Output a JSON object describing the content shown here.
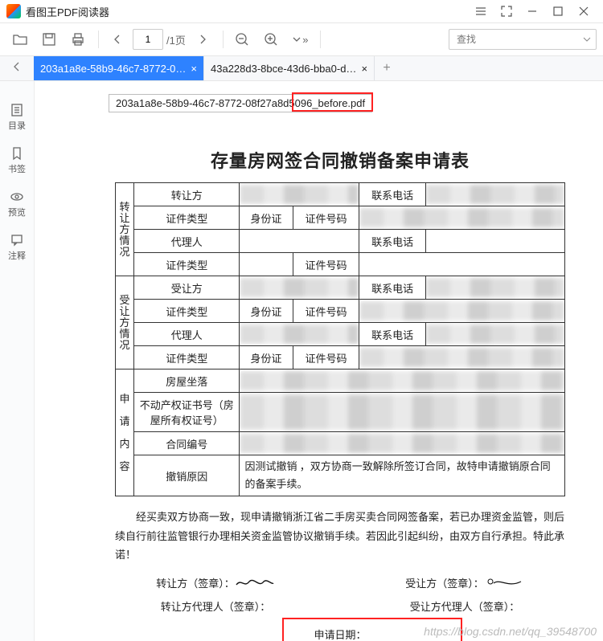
{
  "window": {
    "title": "看图王PDF阅读器"
  },
  "toolbar": {
    "page_current": "1",
    "page_total": "/1页",
    "search_placeholder": "查找"
  },
  "tabs": {
    "items": [
      {
        "label": "203a1a8e-58b9-46c7-8772-0…",
        "active": true
      },
      {
        "label": "43a228d3-8bce-43d6-bba0-d…",
        "active": false
      }
    ]
  },
  "sidebar": {
    "items": [
      {
        "label": "目录"
      },
      {
        "label": "书签"
      },
      {
        "label": "预览"
      },
      {
        "label": "注释"
      }
    ]
  },
  "tooltip_text": "203a1a8e-58b9-46c7-8772-08f27a8d5096_before.pdf",
  "doc": {
    "title": "存量房网签合同撤销备案申请表",
    "labels": {
      "transferor_group": "转让方情况",
      "transferee_group": "受让方情况",
      "app_content_group_a": "申",
      "app_content_group_b": "请",
      "app_content_group_c": "内",
      "app_content_group_d": "容",
      "transferor": "转让方",
      "transferee": "受让方",
      "contact": "联系电话",
      "id_type": "证件类型",
      "id_no": "证件号码",
      "agent": "代理人",
      "id_card": "身份证",
      "house_loc": "房屋坐落",
      "cert_no": "不动产权证书号（房屋所有权证号）",
      "contract_no": "合同编号",
      "cancel_reason": "撤销原因",
      "reason_text": "因测试撤销 ，双方协商一致解除所签订合同，故特申请撤销原合同的备案手续。"
    },
    "declare": "经买卖双方协商一致，现申请撤销浙江省二手房买卖合同网签备案，若已办理资金监管，则后续自行前往监管银行办理相关资金监管协议撤销手续。若因此引起纠纷，由双方自行承担。特此承诺！",
    "sig": {
      "transferor_sign": "转让方（签章）：",
      "transferee_sign": "受让方（签章）：",
      "transferor_agent": "转让方代理人（签章）：",
      "transferee_agent": "受让方代理人（签章）：",
      "apply_date": "申请日期："
    }
  },
  "watermark": "https://blog.csdn.net/qq_39548700"
}
